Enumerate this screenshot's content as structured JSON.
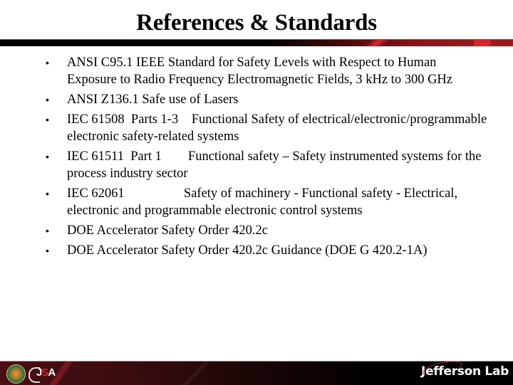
{
  "slide": {
    "title": "References & Standards",
    "bullet_glyph": "•",
    "items": [
      {
        "text": "ANSI C95.1 IEEE Standard for Safety Levels with Respect to Human Exposure to Radio Frequency Electromagnetic Fields, 3 kHz to 300 GHz"
      },
      {
        "text": "ANSI Z136.1 Safe use of Lasers"
      },
      {
        "text": "IEC 61508  Parts 1-3    Functional Safety of electrical/electronic/programmable electronic safety-related systems"
      },
      {
        "text": "IEC 61511  Part 1        Functional safety – Safety instrumented systems for the process industry sector"
      },
      {
        "text": "IEC 62061                  Safety of machinery - Functional safety - Electrical, electronic and programmable electronic control systems"
      },
      {
        "text": "DOE Accelerator Safety Order 420.2c"
      },
      {
        "text": "DOE Accelerator Safety Order 420.2c Guidance (DOE G 420.2-1A)"
      }
    ]
  },
  "footer": {
    "logos": [
      {
        "name": "doe-seal",
        "label": ""
      },
      {
        "name": "jsa-logo",
        "label": "JSA"
      },
      {
        "name": "jefferson-lab-logo",
        "label": "Jefferson Lab"
      }
    ],
    "jsa_parts": [
      "J",
      "S",
      "A"
    ]
  },
  "colors": {
    "accent_red": "#9e1b20",
    "footer_dark": "#000000",
    "text": "#000000"
  }
}
